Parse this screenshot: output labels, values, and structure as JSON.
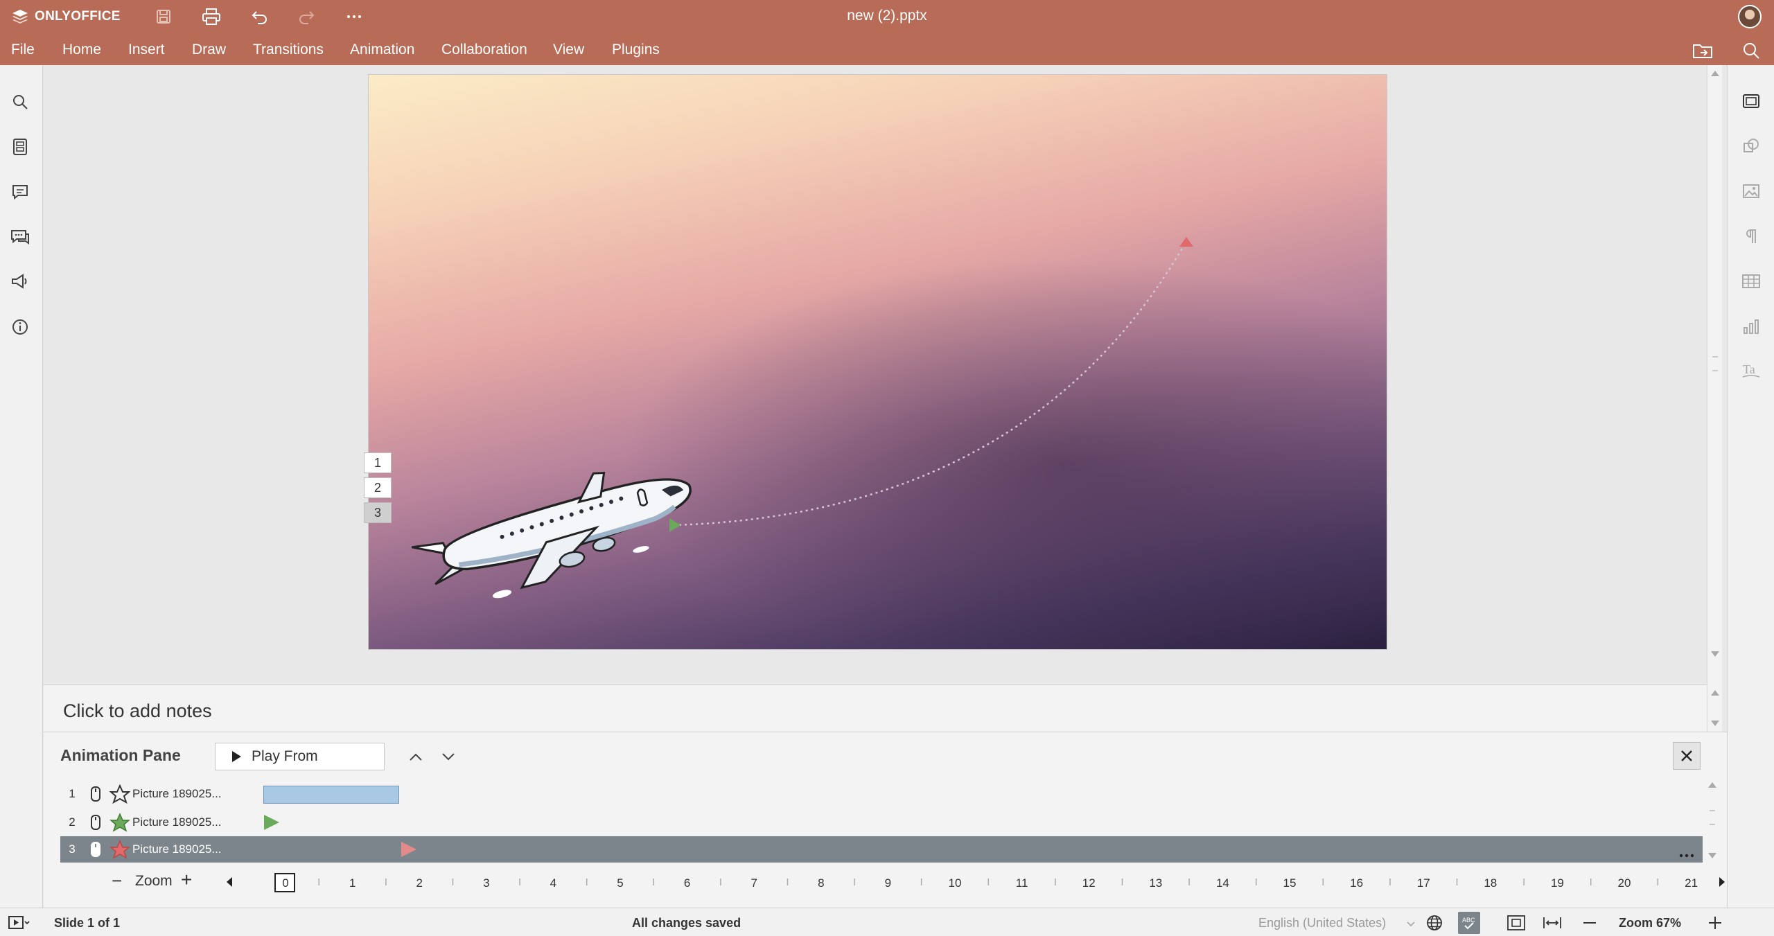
{
  "app": {
    "brand": "ONLYOFFICE",
    "document_title": "new (2).pptx",
    "quick_access_icons": [
      "save-icon",
      "print-icon",
      "undo-icon",
      "redo-icon",
      "more-icon"
    ]
  },
  "menu": [
    "File",
    "Home",
    "Insert",
    "Draw",
    "Transitions",
    "Animation",
    "Collaboration",
    "View",
    "Plugins"
  ],
  "left_sidebar_icons": [
    "search-icon",
    "slides-icon",
    "comments-icon",
    "chat-icon",
    "feedback-icon",
    "about-icon"
  ],
  "right_sidebar_icons": [
    "slide-settings-icon",
    "shape-settings-icon",
    "image-settings-icon",
    "paragraph-settings-icon",
    "table-settings-icon",
    "chart-settings-icon",
    "text-art-icon"
  ],
  "slide": {
    "animation_tags": [
      "1",
      "2",
      "3"
    ]
  },
  "notes": {
    "placeholder": "Click to add notes"
  },
  "animation_pane": {
    "title": "Animation Pane",
    "play_from": "Play From",
    "rows": [
      {
        "num": "1",
        "name": "Picture 189025...",
        "effect": "emphasis",
        "selected": false
      },
      {
        "num": "2",
        "name": "Picture 189025...",
        "effect": "entrance",
        "selected": false
      },
      {
        "num": "3",
        "name": "Picture 189025...",
        "effect": "exit",
        "selected": true
      }
    ],
    "zoom_label": "Zoom",
    "timeline_ticks": [
      "0",
      "1",
      "2",
      "3",
      "4",
      "5",
      "6",
      "7",
      "8",
      "9",
      "10",
      "11",
      "12",
      "13",
      "14",
      "15",
      "16",
      "17",
      "18",
      "19",
      "20",
      "21"
    ]
  },
  "statusbar": {
    "slide_info": "Slide 1 of 1",
    "save_status": "All changes saved",
    "language": "English (United States)",
    "zoom": "Zoom 67%"
  },
  "colors": {
    "titlebar": "#b86b56",
    "selected_row": "#7c858b",
    "entrance_green": "#6aaa5a",
    "exit_red": "#e06a6a",
    "duration_bar": "#a9c8e3"
  }
}
